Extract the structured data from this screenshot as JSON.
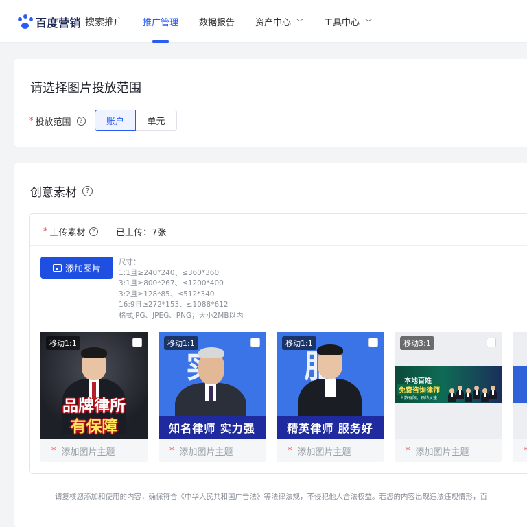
{
  "header": {
    "brand": "百度营销",
    "product": "搜索推广",
    "nav": [
      {
        "label": "推广管理",
        "active": true,
        "dropdown": false
      },
      {
        "label": "数据报告",
        "active": false,
        "dropdown": false
      },
      {
        "label": "资产中心",
        "active": false,
        "dropdown": true
      },
      {
        "label": "工具中心",
        "active": false,
        "dropdown": true
      }
    ],
    "accent_color": "#2a5bf5"
  },
  "scope_card": {
    "title": "请选择图片投放范围",
    "field_required": "*",
    "field_label": "投放范围",
    "options": [
      "账户",
      "单元"
    ],
    "selected": "账户"
  },
  "material_card": {
    "title": "创意素材",
    "upload_required": "*",
    "upload_label": "上传素材",
    "uploaded_text": "已上传：7张",
    "add_button": "添加图片",
    "specs": [
      "尺寸：",
      "1:1且≥240*240、≤360*360",
      "3:1且≥800*267、≤1200*400",
      "3:2且≥128*85、≤512*340",
      "16:9且≥272*153、≤1088*612",
      "格式JPG、JPEG、PNG；大小2MB以内"
    ],
    "thumbnails": [
      {
        "tag": "移动1:1",
        "caption_required": "*",
        "caption": "添加图片主题",
        "art_line1": "品牌律所",
        "art_line2": "有保障"
      },
      {
        "tag": "移动1:1",
        "caption_required": "*",
        "caption": "添加图片主题",
        "art_bg": "实 力",
        "art_banner": "知名律师  实力强"
      },
      {
        "tag": "移动1:1",
        "caption_required": "*",
        "caption": "添加图片主题",
        "art_bg": "服 务",
        "art_banner": "精英律师  服务好"
      },
      {
        "tag": "移动3:1",
        "caption_required": "*",
        "caption": "添加图片主题",
        "art_line1": "本地百姓",
        "art_line2": "免费咨询律师",
        "art_line3": "人数有限，预约从速"
      },
      {
        "tag": "",
        "caption_required": "*",
        "caption": ""
      }
    ],
    "notice": "请复核您添加和使用的内容，确保符合《中华人民共和国广告法》等法律法规，不侵犯他人合法权益。若您的内容出现违法违规情形，百"
  }
}
